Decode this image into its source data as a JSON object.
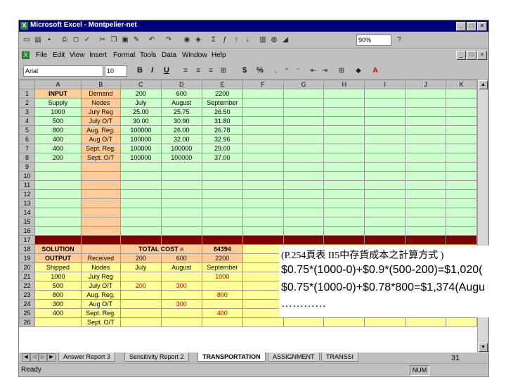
{
  "window": {
    "title": "Microsoft Excel - Montpelier-net"
  },
  "toolbar": {
    "zoom": "90%"
  },
  "menu": [
    "File",
    "Edit",
    "View",
    "Insert",
    "Format",
    "Tools",
    "Data",
    "Window",
    "Help"
  ],
  "format_bar": {
    "font": "Arial",
    "size": "10",
    "bold": "B",
    "italic": "I",
    "underline": "U",
    "currency": "$",
    "percent": "%"
  },
  "columns": [
    "A",
    "B",
    "C",
    "D",
    "E",
    "F",
    "G",
    "H",
    "I",
    "J",
    "K"
  ],
  "rows": [
    {
      "n": "1",
      "cells": [
        "INPUT",
        "Demand",
        "200",
        "600",
        "2200"
      ]
    },
    {
      "n": "2",
      "cells": [
        "Supply",
        "Nodes",
        "July",
        "August",
        "September"
      ]
    },
    {
      "n": "3",
      "cells": [
        "1000",
        "July Reg",
        "25.00",
        "25.75",
        "26.50"
      ]
    },
    {
      "n": "4",
      "cells": [
        "500",
        "July O/T",
        "30.00",
        "30.90",
        "31.80"
      ]
    },
    {
      "n": "5",
      "cells": [
        "800",
        "Aug. Reg.",
        "100000",
        "26.00",
        "26.78"
      ]
    },
    {
      "n": "6",
      "cells": [
        "400",
        "Aug O/T",
        "100000",
        "32.00",
        "32.96"
      ]
    },
    {
      "n": "7",
      "cells": [
        "400",
        "Sept. Reg.",
        "100000",
        "100000",
        "29.00"
      ]
    },
    {
      "n": "8",
      "cells": [
        "200",
        "Sept. O/T",
        "100000",
        "100000",
        "37.00"
      ]
    },
    {
      "n": "9",
      "cells": [
        "",
        "",
        "",
        "",
        ""
      ]
    },
    {
      "n": "10",
      "cells": [
        "",
        "",
        "",
        "",
        ""
      ]
    },
    {
      "n": "11",
      "cells": [
        "",
        "",
        "",
        "",
        ""
      ]
    },
    {
      "n": "12",
      "cells": [
        "",
        "",
        "",
        "",
        ""
      ]
    },
    {
      "n": "13",
      "cells": [
        "",
        "",
        "",
        "",
        ""
      ]
    },
    {
      "n": "14",
      "cells": [
        "",
        "",
        "",
        "",
        ""
      ]
    },
    {
      "n": "15",
      "cells": [
        "",
        "",
        "",
        "",
        ""
      ]
    },
    {
      "n": "16",
      "cells": [
        "",
        "",
        "",
        "",
        ""
      ]
    },
    {
      "n": "17",
      "cells": [
        "",
        "",
        "",
        "",
        ""
      ]
    },
    {
      "n": "18",
      "cells": [
        "SOLUTION",
        "",
        "TOTAL COST =",
        "",
        "84394"
      ]
    },
    {
      "n": "19",
      "cells": [
        "OUTPUT",
        "Received",
        "200",
        "600",
        "2200"
      ]
    },
    {
      "n": "20",
      "cells": [
        "Shipped",
        "Nodes",
        "July",
        "August",
        "September"
      ]
    },
    {
      "n": "21",
      "cells": [
        "1000",
        "July Reg",
        "",
        "",
        "1000"
      ]
    },
    {
      "n": "22",
      "cells": [
        "500",
        "July O/T",
        "200",
        "300",
        ""
      ]
    },
    {
      "n": "23",
      "cells": [
        "800",
        "Aug. Reg.",
        "",
        "",
        "800"
      ]
    },
    {
      "n": "24",
      "cells": [
        "300",
        "Aug O/T",
        "",
        "300",
        ""
      ]
    },
    {
      "n": "25",
      "cells": [
        "400",
        "Sept. Reg.",
        "",
        "",
        "400"
      ]
    },
    {
      "n": "26",
      "cells": [
        "",
        "Sept. O/T",
        "",
        "",
        ""
      ]
    }
  ],
  "sheet_tabs": [
    "Answer Report 3",
    "Sensitivity Report 2",
    "TRANSPORTATION",
    "ASSIGNMENT",
    "TRANSSI"
  ],
  "status": {
    "text": "Ready",
    "num": "NUM"
  },
  "annotation": {
    "line1": "(P.254頁表 II5中存貨成本之計算方式 )",
    "line2": "$0.75*(1000-0)+$0.9*(500-200)=$1,020(",
    "line3": "$0.75*(1000-0)+$0.78*800=$1,374(Augu",
    "line4": "…………"
  },
  "page_number": "31"
}
